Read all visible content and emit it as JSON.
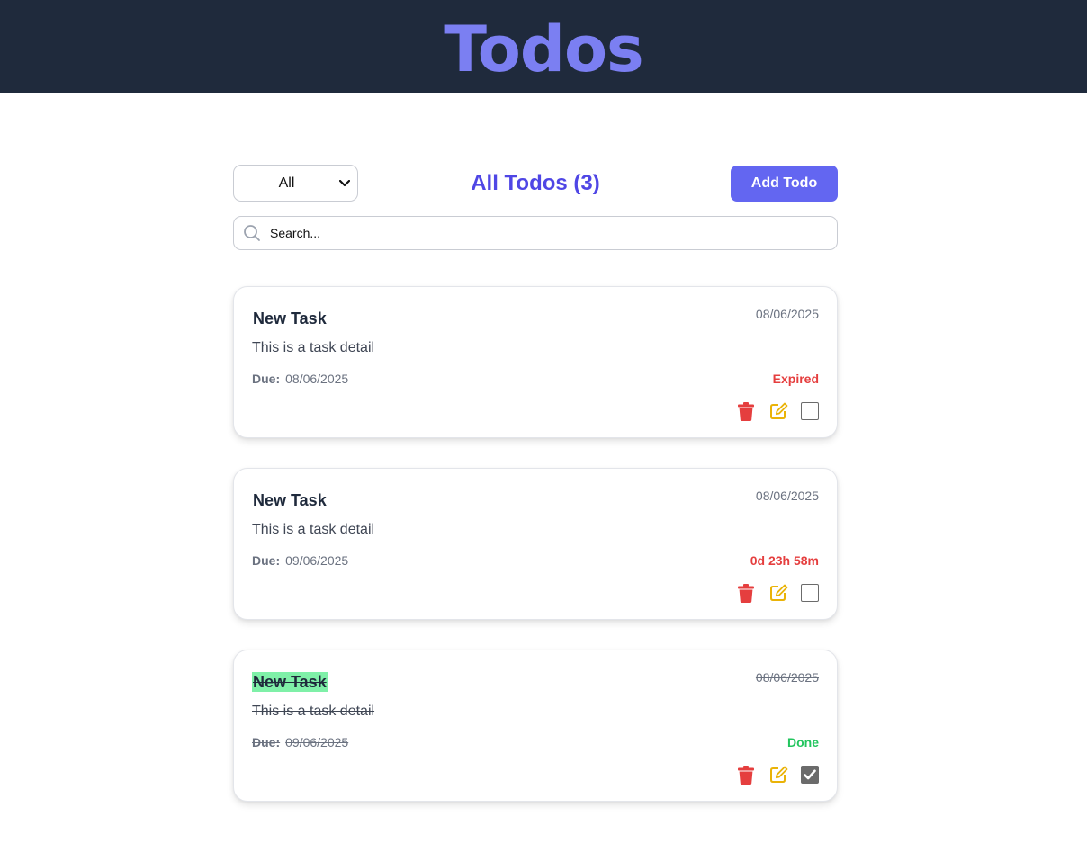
{
  "header": {
    "title": "Todos"
  },
  "toolbar": {
    "filter_value": "All",
    "list_title": "All Todos (3)",
    "add_label": "Add Todo"
  },
  "search": {
    "placeholder": "Search..."
  },
  "due_label": "Due:",
  "colors": {
    "header_bg": "#1f2a3c",
    "header_title": "#7b7ff2",
    "accent": "#6366f1",
    "list_title": "#4f46e5",
    "expired": "#e53e3e",
    "done": "#22c55e",
    "delete_icon": "#e53e3e",
    "edit_icon": "#eab308",
    "done_highlight": "#7ff0a8"
  },
  "todos": [
    {
      "title": "New Task",
      "created": "08/06/2025",
      "detail": "This is a task detail",
      "due": "08/06/2025",
      "status": "Expired",
      "completed": false
    },
    {
      "title": "New Task",
      "created": "08/06/2025",
      "detail": "This is a task detail",
      "due": "09/06/2025",
      "status": "0d 23h 58m",
      "completed": false
    },
    {
      "title": "New Task",
      "created": "08/06/2025",
      "detail": "This is a task detail",
      "due": "09/06/2025",
      "status": "Done",
      "completed": true
    }
  ]
}
